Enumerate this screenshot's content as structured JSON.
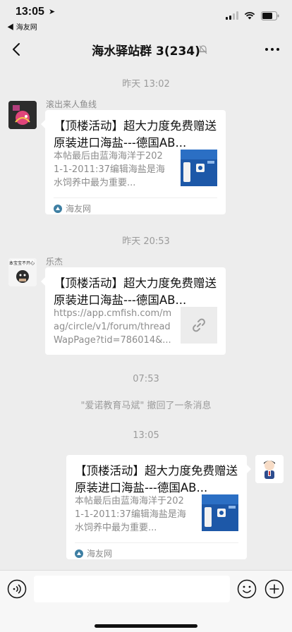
{
  "status_bar": {
    "time": "13:05",
    "back_app": "◀ 海友网"
  },
  "nav": {
    "title": "海水驿站群 3(234)"
  },
  "chat": {
    "timestamps": [
      "昨天 13:02",
      "昨天 20:53",
      "07:53",
      "13:05"
    ],
    "system_message": "\"爱诺教育马斌\" 撤回了一条消息",
    "messages": [
      {
        "sender": "滚出来人鱼线",
        "title": "【顶楼活动】超大力度免费赠送原装进口海盐---德国AB...",
        "description": "本帖最后由蓝海海洋于2021-1-2011:37编辑海盐是海水饲养中最为重要...",
        "source": "海友网"
      },
      {
        "sender": "乐杰",
        "avatar_text": "本宝宝不开心",
        "title": "【顶楼活动】超大力度免费赠送原装进口海盐---德国AB...",
        "description": "https://app.cmfish.com/mag/circle/v1/forum/threadWapPage?tid=786014&..."
      },
      {
        "title": "【顶楼活动】超大力度免费赠送原装进口海盐---德国AB...",
        "description": "本帖最后由蓝海海洋于2021-1-2011:37编辑海盐是海水饲养中最为重要...",
        "source": "海友网"
      }
    ]
  },
  "icons": {
    "back": "chevron-left-icon",
    "mute": "bell-slash-icon",
    "more": "more-dots-icon",
    "link": "link-icon",
    "voice": "voice-icon",
    "emoji": "emoji-icon",
    "plus": "plus-icon"
  },
  "colors": {
    "background": "#ededed",
    "card": "#ffffff",
    "muted_text": "#8c8c8c",
    "source_icon": "#3e7fa3"
  }
}
